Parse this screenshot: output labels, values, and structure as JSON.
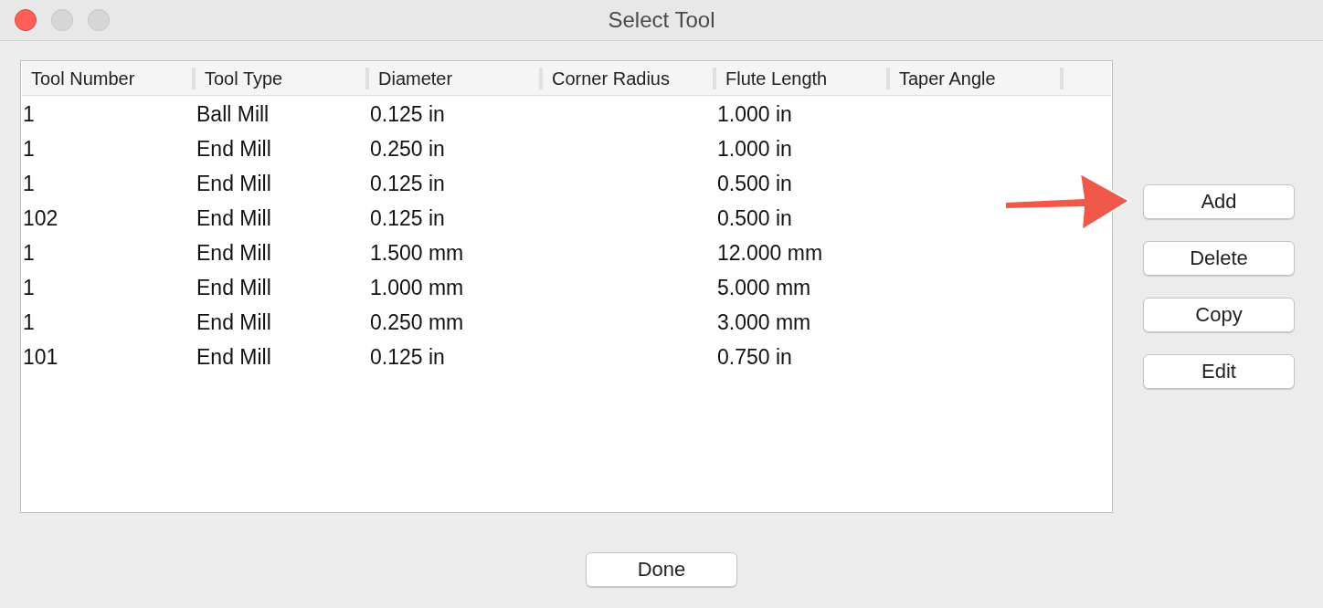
{
  "window": {
    "title": "Select Tool"
  },
  "table": {
    "columns": [
      "Tool Number",
      "Tool Type",
      "Diameter",
      "Corner Radius",
      "Flute Length",
      "Taper Angle"
    ],
    "rows": [
      {
        "tool_number": "1",
        "tool_type": "Ball Mill",
        "diameter": "0.125 in",
        "flute_length": "1.000 in"
      },
      {
        "tool_number": "1",
        "tool_type": "End Mill",
        "diameter": "0.250 in",
        "flute_length": "1.000 in"
      },
      {
        "tool_number": "1",
        "tool_type": "End Mill",
        "diameter": "0.125 in",
        "flute_length": "0.500 in"
      },
      {
        "tool_number": "102",
        "tool_type": "End Mill",
        "diameter": "0.125 in",
        "flute_length": "0.500 in"
      },
      {
        "tool_number": "1",
        "tool_type": "End Mill",
        "diameter": "1.500 mm",
        "flute_length": "12.000 mm"
      },
      {
        "tool_number": "1",
        "tool_type": "End Mill",
        "diameter": "1.000 mm",
        "flute_length": "5.000 mm"
      },
      {
        "tool_number": "1",
        "tool_type": "End Mill",
        "diameter": "0.250 mm",
        "flute_length": "3.000 mm"
      },
      {
        "tool_number": "101",
        "tool_type": "End Mill",
        "diameter": "0.125 in",
        "flute_length": "0.750 in"
      }
    ]
  },
  "side_buttons": [
    "Add",
    "Delete",
    "Copy",
    "Edit"
  ],
  "done_button": "Done"
}
